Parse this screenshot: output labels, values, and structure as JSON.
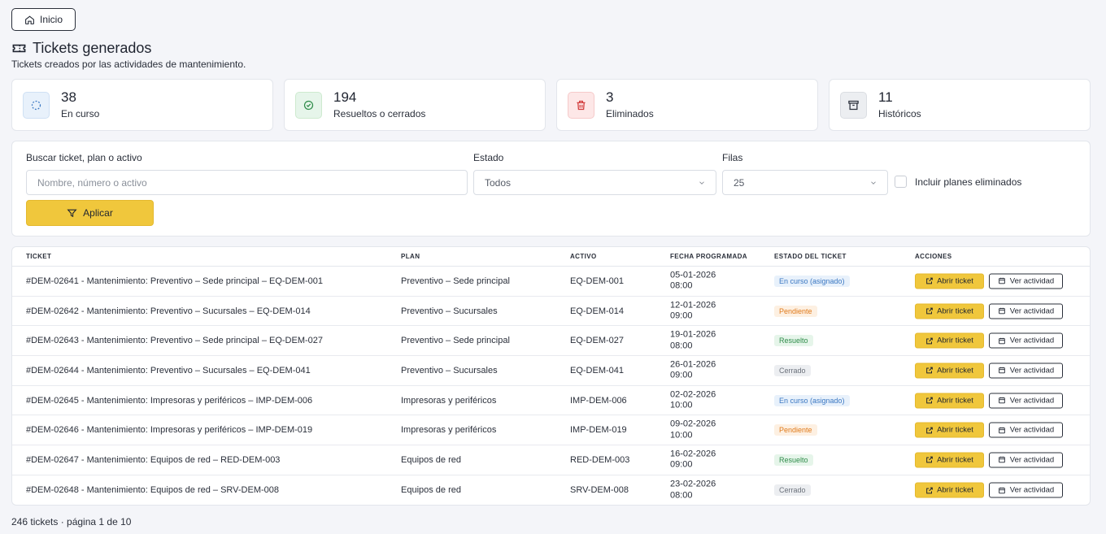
{
  "home_label": "Inicio",
  "header": {
    "title": "Tickets generados",
    "subtitle": "Tickets creados por las actividades de mantenimiento."
  },
  "stats": [
    {
      "value": "38",
      "label": "En curso",
      "icon": "spinner-icon",
      "color": "#3a77c2"
    },
    {
      "value": "194",
      "label": "Resueltos o cerrados",
      "icon": "check-circle-icon",
      "color": "#2f8c4a"
    },
    {
      "value": "3",
      "label": "Eliminados",
      "icon": "trash-icon",
      "color": "#d23b3b"
    },
    {
      "value": "11",
      "label": "Históricos",
      "icon": "archive-icon",
      "color": "#2a2f3a"
    }
  ],
  "filters": {
    "search_label": "Buscar ticket, plan o activo",
    "search_placeholder": "Nombre, número o activo",
    "status_label": "Estado",
    "status_value": "Todos",
    "rows_label": "Filas",
    "rows_value": "25",
    "include_deleted_label": "Incluir planes eliminados",
    "apply_label": "Aplicar"
  },
  "table": {
    "columns": [
      "TICKET",
      "PLAN",
      "ACTIVO",
      "FECHA PROGRAMADA",
      "ESTADO DEL TICKET",
      "ACCIONES"
    ],
    "open_label": "Abrir ticket",
    "view_label": "Ver actividad",
    "rows": [
      {
        "ticket": "#DEM-02641 - Mantenimiento: Preventivo – Sede principal – EQ-DEM-001",
        "plan": "Preventivo – Sede principal",
        "asset": "EQ-DEM-001",
        "date": "05-01-2026",
        "time": "08:00",
        "status": "En curso (asignado)",
        "status_kind": "encurso"
      },
      {
        "ticket": "#DEM-02642 - Mantenimiento: Preventivo – Sucursales – EQ-DEM-014",
        "plan": "Preventivo – Sucursales",
        "asset": "EQ-DEM-014",
        "date": "12-01-2026",
        "time": "09:00",
        "status": "Pendiente",
        "status_kind": "pendiente"
      },
      {
        "ticket": "#DEM-02643 - Mantenimiento: Preventivo – Sede principal – EQ-DEM-027",
        "plan": "Preventivo – Sede principal",
        "asset": "EQ-DEM-027",
        "date": "19-01-2026",
        "time": "08:00",
        "status": "Resuelto",
        "status_kind": "resuelto"
      },
      {
        "ticket": "#DEM-02644 - Mantenimiento: Preventivo – Sucursales – EQ-DEM-041",
        "plan": "Preventivo – Sucursales",
        "asset": "EQ-DEM-041",
        "date": "26-01-2026",
        "time": "09:00",
        "status": "Cerrado",
        "status_kind": "cerrado"
      },
      {
        "ticket": "#DEM-02645 - Mantenimiento: Impresoras y periféricos – IMP-DEM-006",
        "plan": "Impresoras y periféricos",
        "asset": "IMP-DEM-006",
        "date": "02-02-2026",
        "time": "10:00",
        "status": "En curso (asignado)",
        "status_kind": "encurso"
      },
      {
        "ticket": "#DEM-02646 - Mantenimiento: Impresoras y periféricos – IMP-DEM-019",
        "plan": "Impresoras y periféricos",
        "asset": "IMP-DEM-019",
        "date": "09-02-2026",
        "time": "10:00",
        "status": "Pendiente",
        "status_kind": "pendiente"
      },
      {
        "ticket": "#DEM-02647 - Mantenimiento: Equipos de red – RED-DEM-003",
        "plan": "Equipos de red",
        "asset": "RED-DEM-003",
        "date": "16-02-2026",
        "time": "09:00",
        "status": "Resuelto",
        "status_kind": "resuelto"
      },
      {
        "ticket": "#DEM-02648 - Mantenimiento: Equipos de red – SRV-DEM-008",
        "plan": "Equipos de red",
        "asset": "SRV-DEM-008",
        "date": "23-02-2026",
        "time": "08:00",
        "status": "Cerrado",
        "status_kind": "cerrado"
      }
    ]
  },
  "footer": "246 tickets · página 1 de 10"
}
